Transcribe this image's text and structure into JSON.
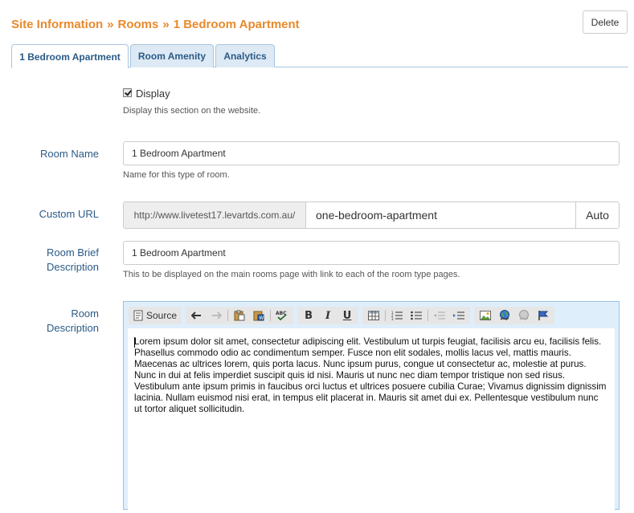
{
  "breadcrumb": {
    "items": [
      "Site Information",
      "Rooms",
      "1 Bedroom Apartment"
    ],
    "separator": "»"
  },
  "header": {
    "delete_label": "Delete"
  },
  "tabs": [
    {
      "label": "1 Bedroom Apartment",
      "active": true
    },
    {
      "label": "Room Amenity",
      "active": false
    },
    {
      "label": "Analytics",
      "active": false
    }
  ],
  "display": {
    "label": "Display",
    "checked": true,
    "help": "Display this section on the website."
  },
  "room_name": {
    "label": "Room Name",
    "value": "1 Bedroom Apartment",
    "help": "Name for this type of room."
  },
  "custom_url": {
    "label": "Custom URL",
    "prefix": "http://www.livetest17.levartds.com.au/",
    "value": "one-bedroom-apartment",
    "auto_label": "Auto"
  },
  "room_brief": {
    "label_line1": "Room Brief",
    "label_line2": "Description",
    "value": "1 Bedroom Apartment",
    "help": "This to be displayed on the main rooms page with link to each of the room type pages."
  },
  "room_description": {
    "label_line1": "Room",
    "label_line2": "Description",
    "toolbar": {
      "source_label": "Source"
    },
    "content": "Lorem ipsum dolor sit amet, consectetur adipiscing elit. Vestibulum ut turpis feugiat, facilisis arcu eu, facilisis felis. Phasellus commodo odio ac condimentum semper. Fusce non elit sodales, mollis lacus vel, mattis mauris. Maecenas ac ultrices lorem, quis porta lacus. Nunc ipsum purus, congue ut consectetur ac, molestie at purus. Nunc in dui at felis imperdiet suscipit quis id nisi. Mauris ut nunc nec diam tempor tristique non sed risus. Vestibulum ante ipsum primis in faucibus orci luctus et ultrices posuere cubilia Curae; Vivamus dignissim dignissim lacinia. Nullam euismod nisi erat, in tempus elit placerat in. Mauris sit amet dui ex. Pellentesque vestibulum nunc ut tortor aliquet sollicitudin."
  },
  "colors": {
    "accent_orange": "#e8892b",
    "label_blue": "#2b5a86",
    "tab_border": "#a9c6df",
    "editor_border": "#9bc2e8"
  }
}
